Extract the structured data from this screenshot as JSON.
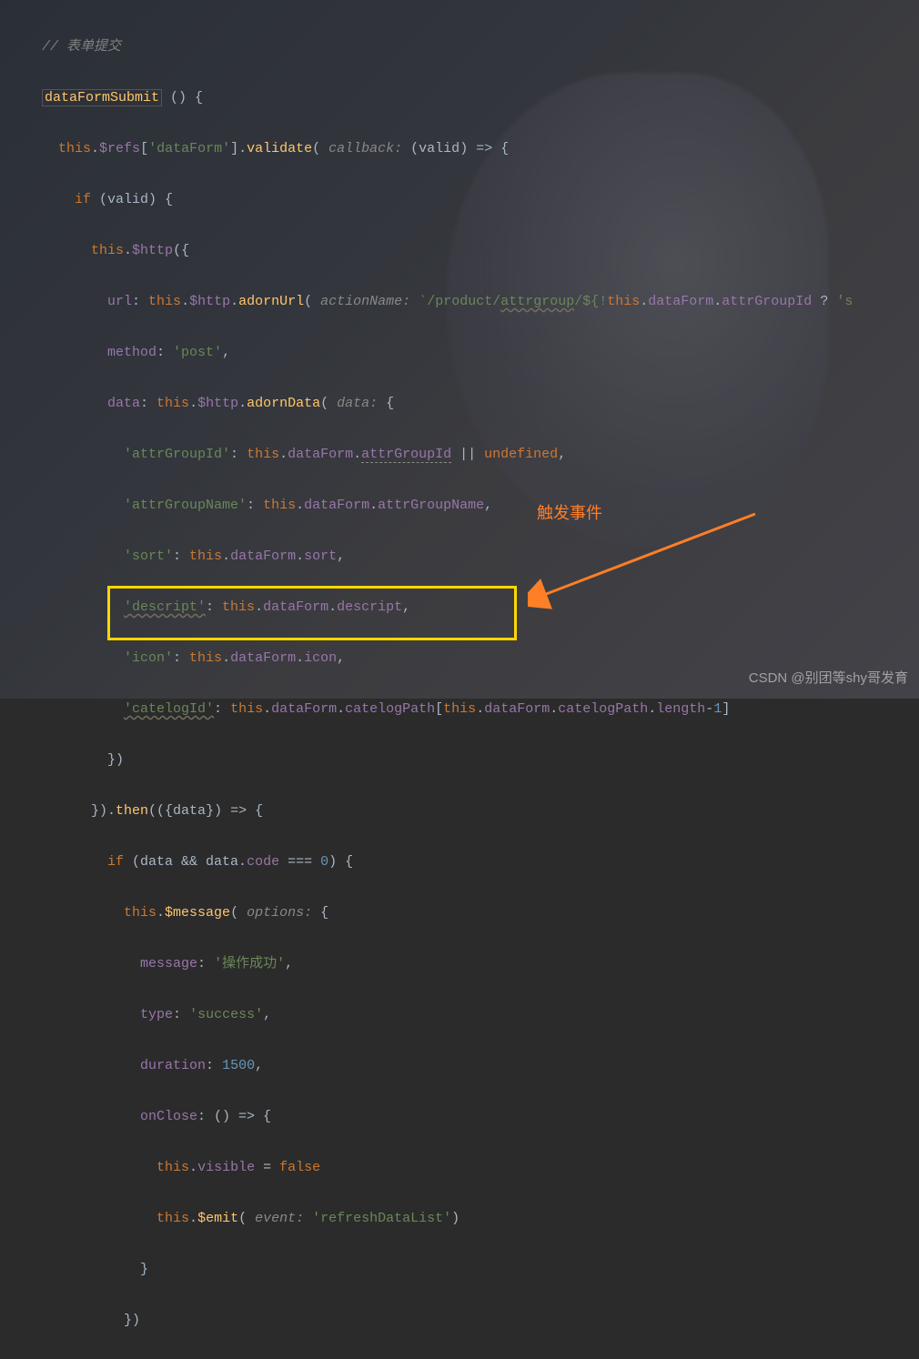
{
  "code": {
    "comment": "// 表单提交",
    "func_name": "dataFormSubmit",
    "l3_refs": "$refs",
    "l3_dataForm": "'dataForm'",
    "l3_validate": "validate",
    "l3_cb": "callback:",
    "l3_valid": "valid",
    "l4_if": "if",
    "l5_http": "$http",
    "l6_url": "url",
    "l6_adornUrl": "adornUrl",
    "l6_an": "actionName:",
    "l6_path": "`/product/",
    "l6_attrgroup": "attrgroup",
    "l6_end": "/${!",
    "l6_df": "dataForm",
    "l6_agi": "attrGroupId",
    "l6_q": " ? ",
    "l6_s": "'s",
    "l7_method": "method",
    "l7_post": "'post'",
    "l8_data": "data",
    "l8_adornData": "adornData",
    "l8_hint": "data:",
    "l9_k": "'attrGroupId'",
    "l9_df": "dataForm",
    "l9_p": "attrGroupId",
    "l9_undef": "undefined",
    "l10_k": "'attrGroupName'",
    "l10_p": "attrGroupName",
    "l11_k": "'sort'",
    "l11_p": "sort",
    "l12_k": "'descript'",
    "l12_p": "descript",
    "l13_k": "'icon'",
    "l13_p": "icon",
    "l14_k": "'catelogId'",
    "l14_p": "catelogPath",
    "l14_len": "length",
    "l17_then": "then",
    "l17_data": "data",
    "l18_code": "code",
    "l18_z": "0",
    "l19_msg": "$message",
    "l19_opt": "options:",
    "l20_k": "message",
    "l20_v": "'操作成功'",
    "l21_k": "type",
    "l21_v": "'success'",
    "l22_k": "duration",
    "l22_v": "1500",
    "l23_k": "onClose",
    "l24_vis": "visible",
    "l24_false": "false",
    "l25_emit": "$emit",
    "l25_ev": "event:",
    "l25_v": "'refreshDataList'"
  },
  "annotation": "触发事件",
  "watermark": "CSDN @别团等shy哥发育"
}
